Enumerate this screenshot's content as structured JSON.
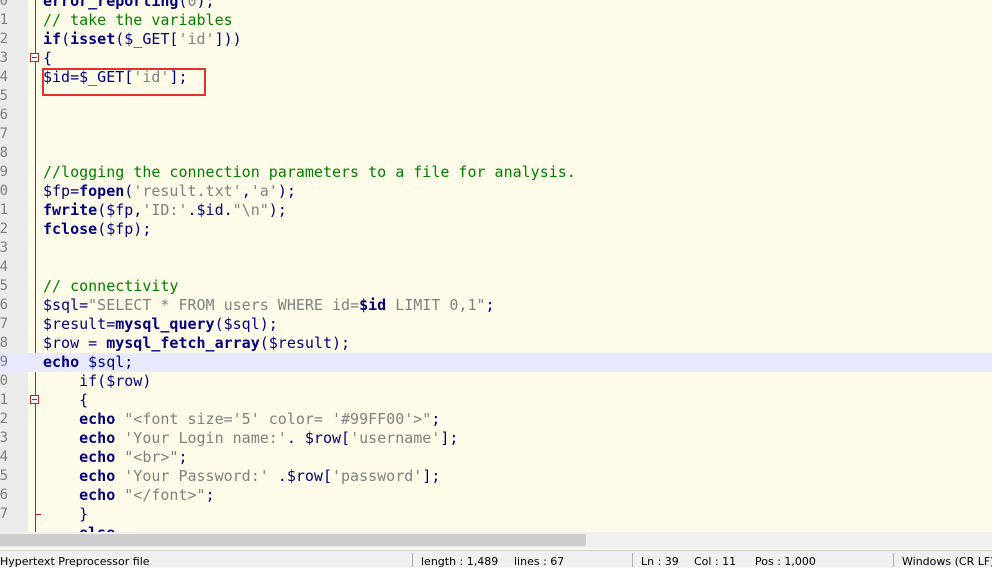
{
  "editor": {
    "lines": [
      {
        "num": "0",
        "tokens": [
          {
            "t": "error_reporting",
            "c": "fn"
          },
          {
            "t": "(",
            "c": "pl"
          },
          {
            "t": "0",
            "c": "str"
          },
          {
            "t": ");",
            "c": "pl"
          }
        ]
      },
      {
        "num": "1",
        "tokens": [
          {
            "t": "// take the variables",
            "c": "cm"
          }
        ]
      },
      {
        "num": "2",
        "tokens": [
          {
            "t": "if",
            "c": "fn"
          },
          {
            "t": "(",
            "c": "pl"
          },
          {
            "t": "isset",
            "c": "fn"
          },
          {
            "t": "($_GET[",
            "c": "pl"
          },
          {
            "t": "'id'",
            "c": "str"
          },
          {
            "t": "]))",
            "c": "pl"
          }
        ]
      },
      {
        "num": "3",
        "fold": "start",
        "tokens": [
          {
            "t": "{",
            "c": "pl"
          }
        ]
      },
      {
        "num": "4",
        "tokens": [
          {
            "t": "$id",
            "c": "var"
          },
          {
            "t": "=$_GET[",
            "c": "pl"
          },
          {
            "t": "'id'",
            "c": "str"
          },
          {
            "t": "];",
            "c": "pl"
          }
        ]
      },
      {
        "num": "5",
        "tokens": []
      },
      {
        "num": "6",
        "tokens": []
      },
      {
        "num": "7",
        "tokens": []
      },
      {
        "num": "8",
        "tokens": []
      },
      {
        "num": "9",
        "tokens": [
          {
            "t": "//logging the connection parameters to a file for analysis.",
            "c": "cm"
          }
        ]
      },
      {
        "num": "0",
        "tokens": [
          {
            "t": "$fp",
            "c": "var"
          },
          {
            "t": "=",
            "c": "pl"
          },
          {
            "t": "fopen",
            "c": "fn"
          },
          {
            "t": "(",
            "c": "pl"
          },
          {
            "t": "'result.txt'",
            "c": "str"
          },
          {
            "t": ",",
            "c": "pl"
          },
          {
            "t": "'a'",
            "c": "str"
          },
          {
            "t": ");",
            "c": "pl"
          }
        ]
      },
      {
        "num": "1",
        "tokens": [
          {
            "t": "fwrite",
            "c": "fn"
          },
          {
            "t": "($fp,",
            "c": "pl"
          },
          {
            "t": "'ID:'",
            "c": "str"
          },
          {
            "t": ".$id.",
            "c": "pl"
          },
          {
            "t": "\"\\n\"",
            "c": "str"
          },
          {
            "t": ");",
            "c": "pl"
          }
        ]
      },
      {
        "num": "2",
        "tokens": [
          {
            "t": "fclose",
            "c": "fn"
          },
          {
            "t": "($fp);",
            "c": "pl"
          }
        ]
      },
      {
        "num": "3",
        "tokens": []
      },
      {
        "num": "4",
        "tokens": []
      },
      {
        "num": "5",
        "tokens": [
          {
            "t": "// connectivity",
            "c": "cm"
          }
        ]
      },
      {
        "num": "6",
        "tokens": [
          {
            "t": "$sql",
            "c": "var"
          },
          {
            "t": "=",
            "c": "pl"
          },
          {
            "t": "\"SELECT * FROM users WHERE id=",
            "c": "str"
          },
          {
            "t": "$id",
            "c": "fn"
          },
          {
            "t": " LIMIT 0,1\"",
            "c": "str"
          },
          {
            "t": ";",
            "c": "pl"
          }
        ]
      },
      {
        "num": "7",
        "tokens": [
          {
            "t": "$result",
            "c": "var"
          },
          {
            "t": "=",
            "c": "pl"
          },
          {
            "t": "mysql_query",
            "c": "fn"
          },
          {
            "t": "($sql);",
            "c": "pl"
          }
        ]
      },
      {
        "num": "8",
        "tokens": [
          {
            "t": "$row = ",
            "c": "pl"
          },
          {
            "t": "mysql_fetch_array",
            "c": "fn"
          },
          {
            "t": "($result);",
            "c": "pl"
          }
        ]
      },
      {
        "num": "9",
        "current": true,
        "tokens": [
          {
            "t": "echo",
            "c": "fn"
          },
          {
            "t": " $sql;",
            "c": "pl"
          }
        ]
      },
      {
        "num": "0",
        "tokens": [
          {
            "t": "    if($row)",
            "c": "pl"
          }
        ]
      },
      {
        "num": "1",
        "fold": "start",
        "tokens": [
          {
            "t": "    {",
            "c": "pl"
          }
        ]
      },
      {
        "num": "2",
        "tokens": [
          {
            "t": "    ",
            "c": "pl"
          },
          {
            "t": "echo",
            "c": "fn"
          },
          {
            "t": " ",
            "c": "pl"
          },
          {
            "t": "\"<font size='5' color= '#99FF00'>\"",
            "c": "str"
          },
          {
            "t": ";",
            "c": "pl"
          }
        ]
      },
      {
        "num": "3",
        "tokens": [
          {
            "t": "    ",
            "c": "pl"
          },
          {
            "t": "echo",
            "c": "fn"
          },
          {
            "t": " ",
            "c": "pl"
          },
          {
            "t": "'Your Login name:'",
            "c": "str"
          },
          {
            "t": ". $row[",
            "c": "pl"
          },
          {
            "t": "'username'",
            "c": "str"
          },
          {
            "t": "];",
            "c": "pl"
          }
        ]
      },
      {
        "num": "4",
        "tokens": [
          {
            "t": "    ",
            "c": "pl"
          },
          {
            "t": "echo",
            "c": "fn"
          },
          {
            "t": " ",
            "c": "pl"
          },
          {
            "t": "\"<br>\"",
            "c": "str"
          },
          {
            "t": ";",
            "c": "pl"
          }
        ]
      },
      {
        "num": "5",
        "tokens": [
          {
            "t": "    ",
            "c": "pl"
          },
          {
            "t": "echo",
            "c": "fn"
          },
          {
            "t": " ",
            "c": "pl"
          },
          {
            "t": "'Your Password:'",
            "c": "str"
          },
          {
            "t": " .$row[",
            "c": "pl"
          },
          {
            "t": "'password'",
            "c": "str"
          },
          {
            "t": "];",
            "c": "pl"
          }
        ]
      },
      {
        "num": "6",
        "tokens": [
          {
            "t": "    ",
            "c": "pl"
          },
          {
            "t": "echo",
            "c": "fn"
          },
          {
            "t": " ",
            "c": "pl"
          },
          {
            "t": "\"</font>\"",
            "c": "str"
          },
          {
            "t": ";",
            "c": "pl"
          }
        ]
      },
      {
        "num": "7",
        "fold": "end",
        "tokens": [
          {
            "t": "    }",
            "c": "pl"
          }
        ]
      },
      {
        "num": "",
        "tokens": [
          {
            "t": "    else",
            "c": "fn"
          }
        ]
      }
    ]
  },
  "status": {
    "file_type": "Hypertext Preprocessor file",
    "length": "length : 1,489",
    "lines": "lines : 67",
    "ln": "Ln : 39",
    "col": "Col : 11",
    "pos": "Pos : 1,000",
    "eol": "Windows (CR LF)"
  },
  "colors": {
    "editor_bg": "#fefce8",
    "current_line": "#e8e8ff",
    "keyword": "#000080",
    "string": "#808080",
    "comment": "#008000",
    "highlight_box": "#e03030"
  }
}
